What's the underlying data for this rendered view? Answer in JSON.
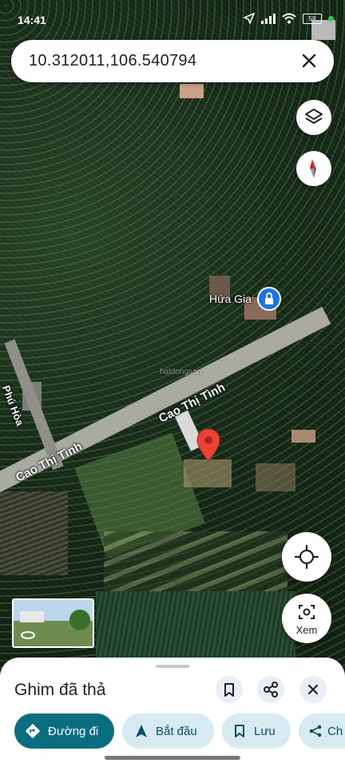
{
  "status_bar": {
    "time": "14:41",
    "battery": "59"
  },
  "search": {
    "query": "10.312011,106.540794"
  },
  "map": {
    "roads": [
      {
        "name": "Cao Thị Tình"
      },
      {
        "name": "Cao Thị Tình"
      },
      {
        "name": "Phú Hòa"
      }
    ],
    "poi": {
      "name": "Hứa Gia"
    },
    "watermark": "batdongsan"
  },
  "controls": {
    "streetview_label": "Xem"
  },
  "sheet": {
    "title": "Ghim đã thả",
    "actions": [
      {
        "label": "Đường đi"
      },
      {
        "label": "Bắt đầu"
      },
      {
        "label": "Lưu"
      },
      {
        "label": "Ch"
      }
    ]
  },
  "colors": {
    "pin": "#ea4335",
    "primary": "#0b6e80",
    "secondary_chip": "#d7eaf2"
  }
}
